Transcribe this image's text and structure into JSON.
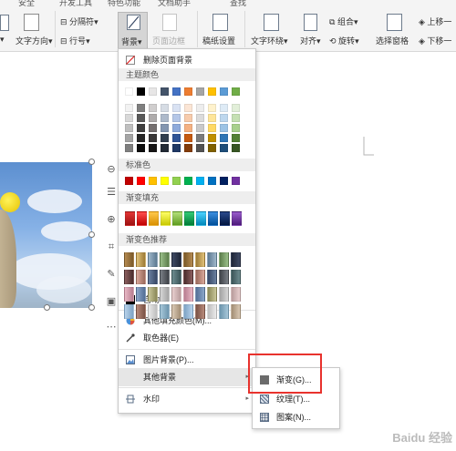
{
  "ribbon": {
    "top_cut": [
      "安全",
      "开发工具",
      "特色功能",
      "文档助手",
      "查找"
    ],
    "text_direction": "文字方向",
    "separator": "分隔符",
    "line_number": "行号",
    "background": "背景",
    "page_border": "页面边框",
    "paper_settings": "稿纸设置",
    "text_wrap": "文字环绕",
    "align": "对齐",
    "group": "组合",
    "rotate": "旋转",
    "selection_pane": "选择窗格",
    "bring_forward": "上移一",
    "send_backward": "下移一"
  },
  "menu": {
    "remove_background": "删除页面背景",
    "theme_colors_header": "主题颜色",
    "standard_colors_header": "标准色",
    "gradient_fill_header": "渐变填充",
    "gradient_recommend_header": "渐变色推荐",
    "auto": "自动",
    "more_fill_colors": "其他填充颜色(M)...",
    "eyedropper": "取色器(E)",
    "picture_background": "图片背景(P)...",
    "other_background": "其他背景",
    "watermark": "水印"
  },
  "submenu": {
    "gradient": "渐变(G)...",
    "texture": "纹理(T)...",
    "pattern": "图案(N)..."
  },
  "colors": {
    "theme_top": [
      "#ffffff",
      "#000000",
      "#e7e6e6",
      "#44546a",
      "#4472c4",
      "#ed7d31",
      "#a5a5a5",
      "#ffc000",
      "#5b9bd5",
      "#70ad47"
    ],
    "theme_shades": [
      [
        "#f2f2f2",
        "#7f7f7f",
        "#d0cece",
        "#d6dce4",
        "#d9e2f3",
        "#fbe5d5",
        "#ededed",
        "#fff2cc",
        "#deebf6",
        "#e2efd9"
      ],
      [
        "#d8d8d8",
        "#595959",
        "#aeabab",
        "#adb9ca",
        "#b4c6e7",
        "#f7cbac",
        "#dbdbdb",
        "#fee599",
        "#bdd7ee",
        "#c5e0b3"
      ],
      [
        "#bfbfbf",
        "#3f3f3f",
        "#757070",
        "#8496b0",
        "#8eaadb",
        "#f4b183",
        "#c9c9c9",
        "#ffd965",
        "#9cc3e5",
        "#a8d08d"
      ],
      [
        "#a5a5a5",
        "#262626",
        "#3a3838",
        "#323f4f",
        "#2f5496",
        "#c55a11",
        "#7b7b7b",
        "#bf8f00",
        "#2e75b5",
        "#538135"
      ],
      [
        "#7f7f7f",
        "#0c0c0c",
        "#171616",
        "#222a35",
        "#1f3864",
        "#833c0b",
        "#525252",
        "#7f6000",
        "#1e4e79",
        "#375623"
      ]
    ],
    "standard": [
      "#c00000",
      "#ff0000",
      "#ffc000",
      "#ffff00",
      "#92d050",
      "#00b050",
      "#00b0f0",
      "#0070c0",
      "#002060",
      "#7030a0"
    ],
    "gradient_fill": [
      [
        "#e23434",
        "#9e1212"
      ],
      [
        "#ff4d4d",
        "#c00000"
      ],
      [
        "#ffc94d",
        "#d99000"
      ],
      [
        "#ffff66",
        "#c8c800"
      ],
      [
        "#b4e07a",
        "#5e9c1f"
      ],
      [
        "#33cc77",
        "#007a37"
      ],
      [
        "#4dd2ff",
        "#0088bb"
      ],
      [
        "#3d8fe0",
        "#004f99"
      ],
      [
        "#2a4a8c",
        "#001540"
      ],
      [
        "#9a5ccc",
        "#4d1a7a"
      ]
    ],
    "gradient_recommend": [
      [
        "#b58a50",
        "#7a5a2a"
      ],
      [
        "#e1c27a",
        "#9c7a36"
      ],
      [
        "#9fb7c9",
        "#5d7a92"
      ],
      [
        "#9bbf8a",
        "#5b7d4a"
      ],
      [
        "#3f4a64",
        "#1f2638"
      ],
      [
        "#8b5e5e",
        "#4a2d2d"
      ],
      [
        "#d9a79a",
        "#9a6a5c"
      ],
      [
        "#6a7fa0",
        "#384866"
      ],
      [
        "#7a7f86",
        "#3e4248"
      ],
      [
        "#6d8c8f",
        "#3b5558"
      ],
      [
        "#e8b7c5",
        "#b87e90"
      ],
      [
        "#8ba6c9",
        "#536f96"
      ],
      [
        "#c9c79a",
        "#8a8757"
      ],
      [
        "#d6d6d6",
        "#a3a3a3"
      ],
      [
        "#e8cfcf",
        "#b89c9c"
      ],
      [
        "#b7d2ea",
        "#7ea3c5"
      ],
      [
        "#b88a7a",
        "#7a5246"
      ],
      [
        "#eaeaea",
        "#bdbdbd"
      ],
      [
        "#a7c7d9",
        "#6c95ad"
      ],
      [
        "#d9c8b4",
        "#a38e74"
      ]
    ],
    "auto": "#000000",
    "highlight": "#e8322d",
    "menu_hover": "#e6e6e6"
  },
  "watermark": "Baidu 经验"
}
